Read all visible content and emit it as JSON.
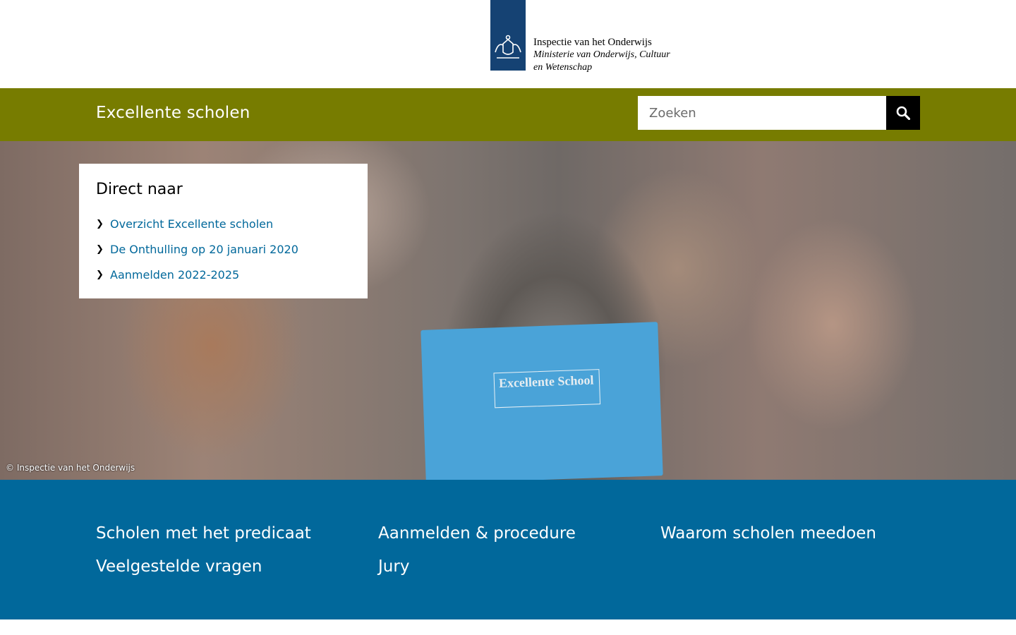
{
  "header": {
    "org_name": "Inspectie van het Onderwijs",
    "ministry_name": "Ministerie van Onderwijs, Cultuur en Wetenschap",
    "logo_color": "#154273"
  },
  "bar": {
    "site_title": "Excellente scholen",
    "background": "#777c00",
    "search_placeholder": "Zoeken",
    "search_icon": "search-icon"
  },
  "hero": {
    "folder_label": "Excellente School",
    "credit": "© Inspectie van het Onderwijs"
  },
  "quick_links": {
    "title": "Direct naar",
    "items": [
      {
        "label": "Overzicht Excellente scholen"
      },
      {
        "label": "De Onthulling op 20 januari 2020"
      },
      {
        "label": "Aanmelden 2022-2025"
      }
    ]
  },
  "nav": {
    "background": "#01689b",
    "items": [
      {
        "label": "Scholen met het predicaat"
      },
      {
        "label": "Aanmelden & procedure"
      },
      {
        "label": "Waarom scholen meedoen"
      },
      {
        "label": "Veelgestelde vragen"
      },
      {
        "label": "Jury"
      }
    ]
  }
}
